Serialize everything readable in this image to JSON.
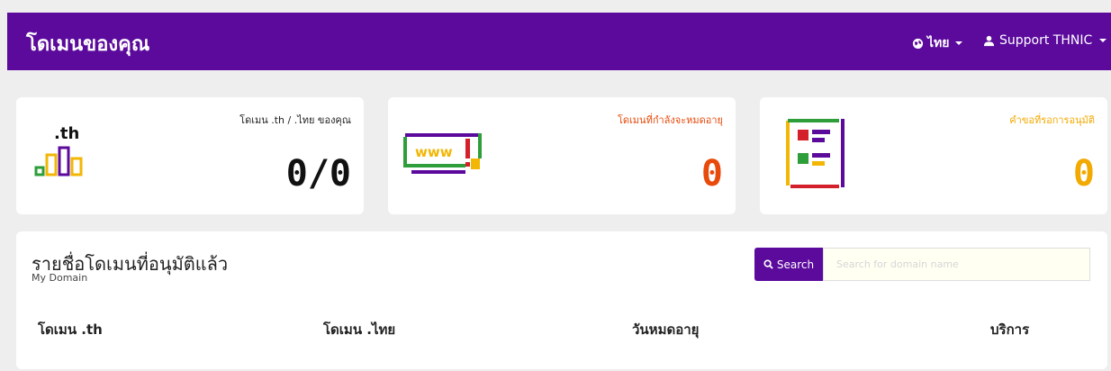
{
  "header": {
    "title": "โดเมนของคุณ",
    "lang_label": "ไทย",
    "user_label": "Support THNIC"
  },
  "cards": [
    {
      "label": "โดเมน .th / .ไทย ของคุณ",
      "count": "0/0",
      "icon_text": ".th",
      "color": "#111111"
    },
    {
      "label": "โดเมนที่กำลังจะหมดอายุ",
      "count": "0",
      "icon_text": "www",
      "color": "#e84a0c"
    },
    {
      "label": "คำขอที่รอการอนุมัติ",
      "count": "0",
      "color": "#f2a900"
    }
  ],
  "domains": {
    "title": "รายชื่อโดเมนที่อนุมัติแล้ว",
    "subtitle": "My Domain",
    "search_button": "Search",
    "search_placeholder": "Search for domain name",
    "columns": [
      "โดเมน .th",
      "โดเมน .ไทย",
      "วันหมดอายุ",
      "บริการ"
    ]
  },
  "colors": {
    "brand": "#5b0a9c",
    "green": "#2e9e3a",
    "yellow": "#f2b705",
    "orange": "#e84a0c",
    "red": "#d4202a"
  }
}
